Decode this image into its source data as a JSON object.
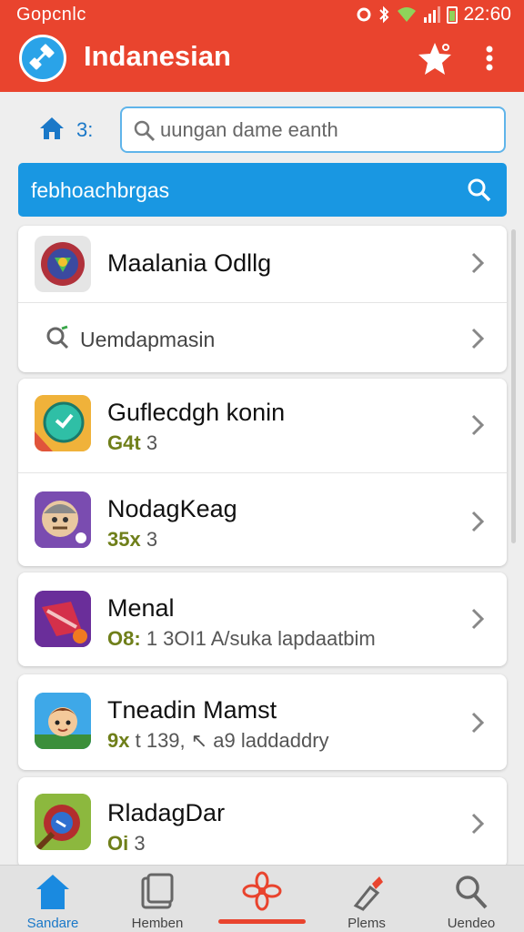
{
  "status_bar": {
    "left_text": "Gopcnlc",
    "time": "22:60"
  },
  "app_bar": {
    "title": "Indanesian"
  },
  "toolbar": {
    "home_label": "3:",
    "search_placeholder": "uungan dame eanth"
  },
  "banner": {
    "label": "febhoachbrgas"
  },
  "list": {
    "items": [
      {
        "title": "Maalania Odllg",
        "subtitle": "",
        "meta": ""
      },
      {
        "title": "Uemdapmasin",
        "subtitle": "",
        "meta": ""
      },
      {
        "title": "Guflecdgh konin",
        "meta": "G4t",
        "subtitle": "3"
      },
      {
        "title": "NodagKeag",
        "meta": "35x",
        "subtitle": "3"
      },
      {
        "title": "Menal",
        "meta": "O8:",
        "subtitle": "1 3OI1 A/suka lapdaatbim"
      },
      {
        "title": "Tneadin Mamst",
        "meta": "9x",
        "subtitle": "t 139, ↖ a9 laddaddry"
      },
      {
        "title": "RladagDar",
        "meta": "Oi",
        "subtitle": "3"
      }
    ]
  },
  "bottom_nav": {
    "items": [
      {
        "label": "Sandare"
      },
      {
        "label": "Hemben"
      },
      {
        "label": ""
      },
      {
        "label": "Plems"
      },
      {
        "label": "Uendeo"
      }
    ]
  },
  "colors": {
    "app_bar": "#e9442e",
    "accent_blue": "#1997e2",
    "meta_green": "#6f7f1a"
  }
}
